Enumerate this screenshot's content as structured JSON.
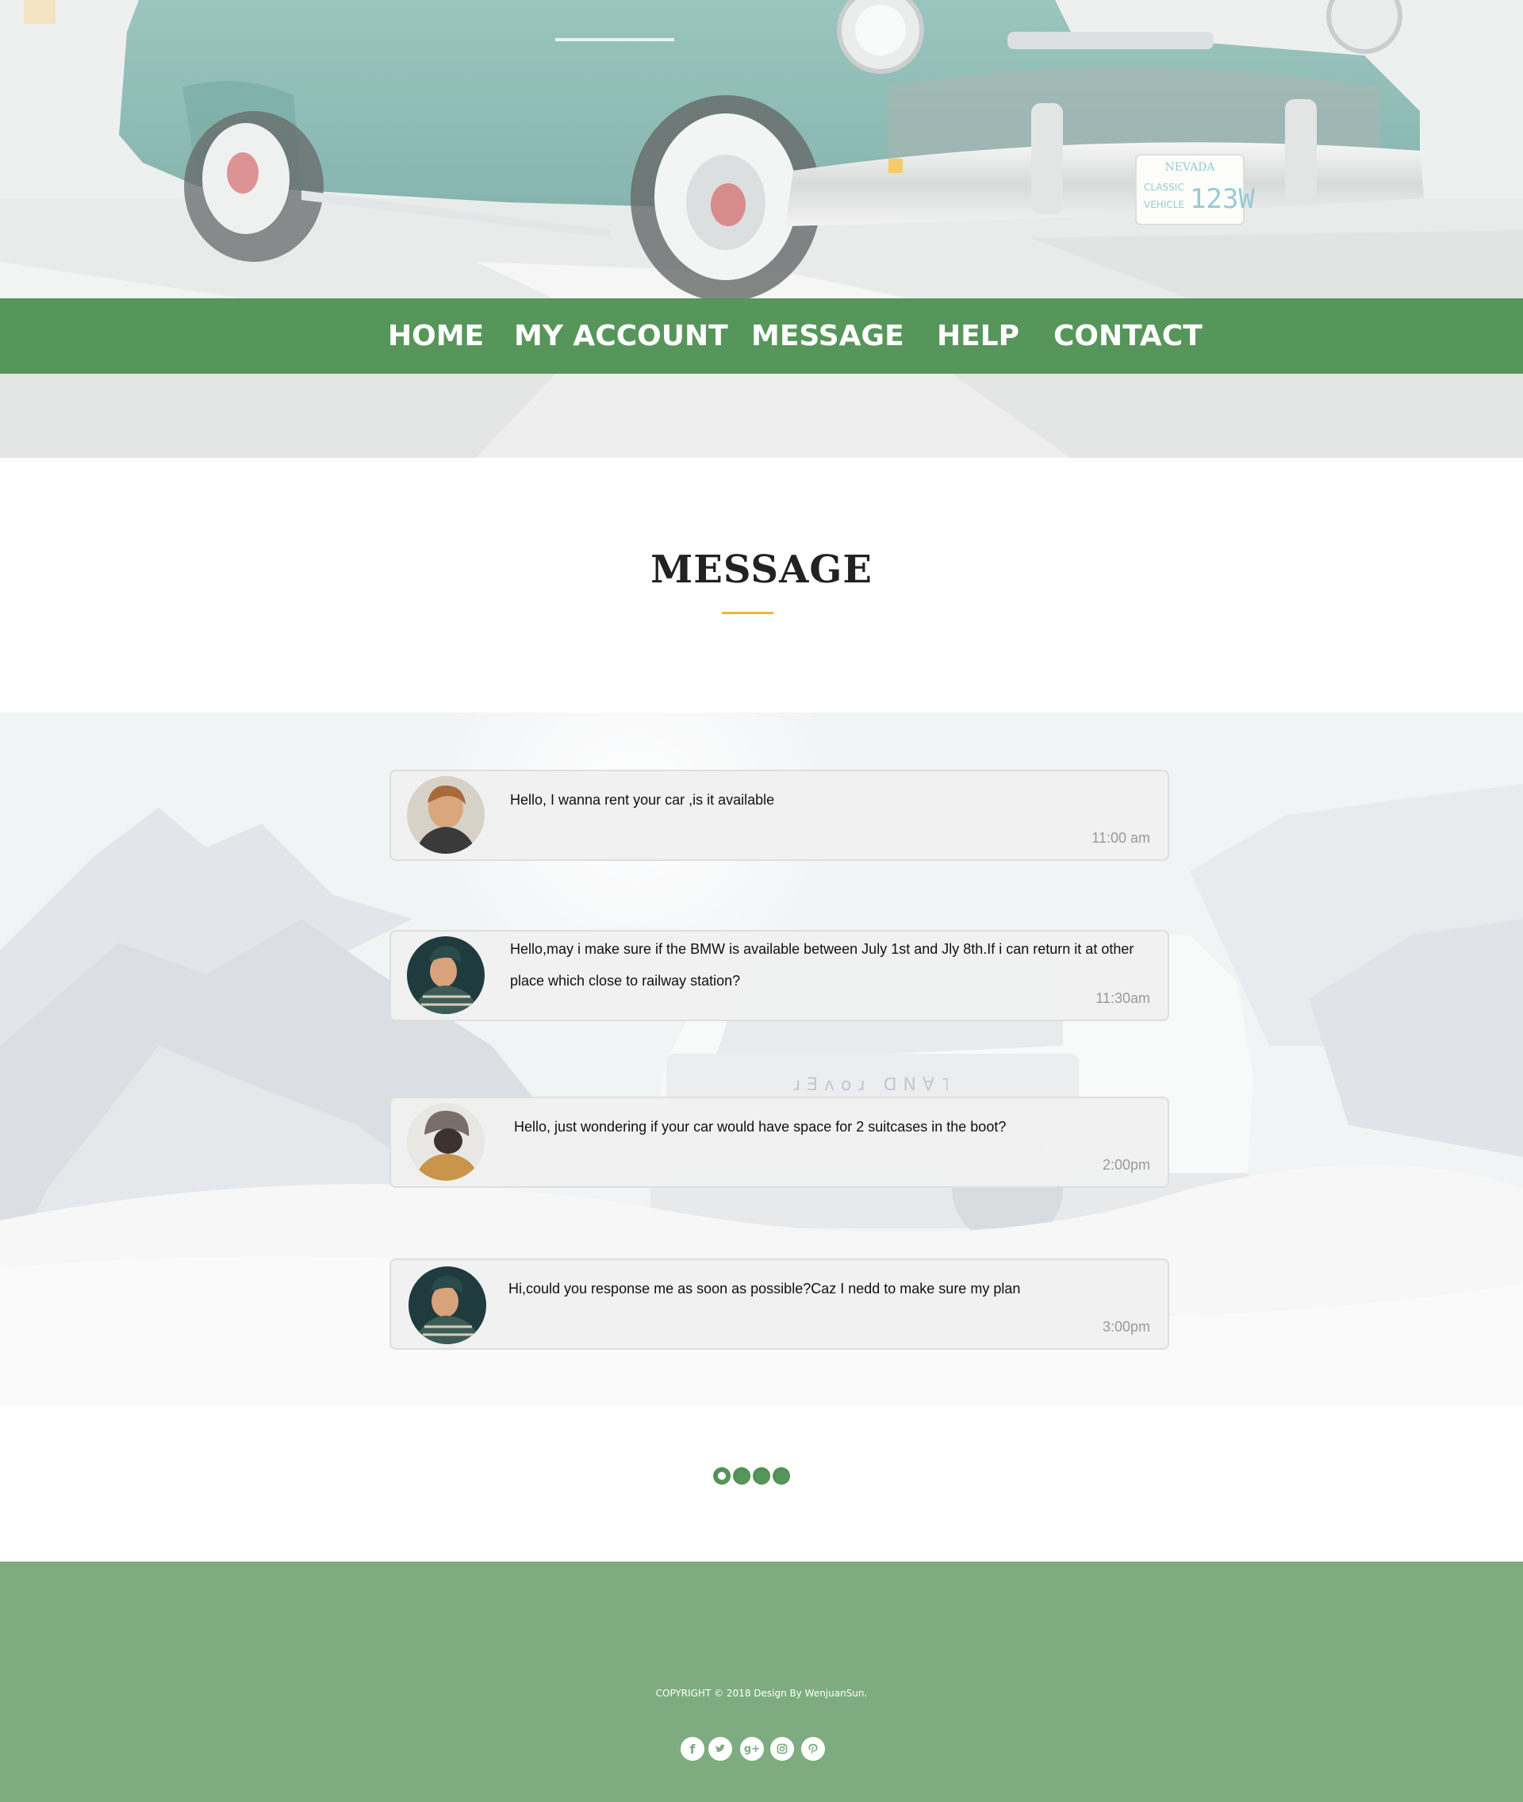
{
  "nav": {
    "home": "HOME",
    "account": "MY ACCOUNT",
    "message": "MESSAGE",
    "help": "HELP",
    "contact": "CONTACT"
  },
  "hero": {
    "plate_state": "NEVADA",
    "plate_line1": "CLASSIC",
    "plate_line2": "VEHICLE",
    "plate_number": "123W"
  },
  "section": {
    "title": "MESSAGE"
  },
  "messages": [
    {
      "text": "Hello, I wanna rent your car ,is it available",
      "time": "11:00 am",
      "avatar": "avatar-man-profile"
    },
    {
      "text": "Hello,may i  make sure if the BMW is available between July 1st and Jly 8th.If i can return it at other place which close to railway station?",
      "time": "11:30am",
      "avatar": "avatar-man-beanie-sweater"
    },
    {
      "text": "Hello, just wondering if your car would have space for 2 suitcases in the boot?",
      "time": "2:00pm",
      "avatar": "avatar-grey-beanie-jacket"
    },
    {
      "text": "Hi,could you response me as soon as possible?Caz I nedd to make sure my plan",
      "time": "3:00pm",
      "avatar": "avatar-man-beanie-sweater"
    }
  ],
  "pagination": {
    "pages": 4,
    "current": 1
  },
  "footer": {
    "copyright": "COPYRIGHT © 2018 Design By WenjuanSun.",
    "social": [
      "facebook-icon",
      "twitter-icon",
      "google-plus-icon",
      "instagram-icon",
      "pinterest-icon"
    ]
  },
  "colors": {
    "nav_green": "#57965a",
    "footer_green": "#7eac80",
    "accent_yellow": "#f2b632",
    "card_bg": "#f0f0f0"
  }
}
